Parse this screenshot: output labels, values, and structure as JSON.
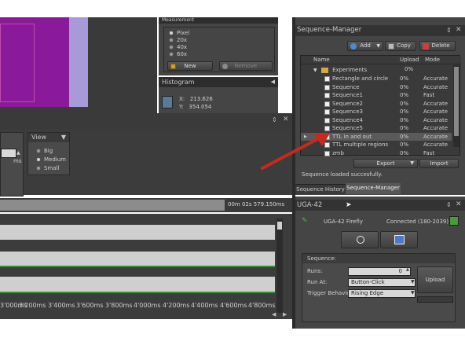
{
  "measurement": {
    "title": "Measurement",
    "options": [
      "Pixel",
      "20x",
      "40x",
      "60x"
    ],
    "selected": "Pixel",
    "new_label": "New",
    "remove_label": "Remove"
  },
  "histogram": {
    "title": "Histogram",
    "x_label": "X:",
    "x_value": "213.626",
    "y_label": "Y:",
    "y_value": "354.054"
  },
  "left_panel": {
    "unit": "ms",
    "view": {
      "title": "View",
      "options": [
        "Big",
        "Medium",
        "Small"
      ],
      "selected": "Medium"
    }
  },
  "timeline": {
    "time_readout": "00m 02s 579.150ms",
    "ticks": [
      "3'000ms",
      "3'200ms",
      "3'400ms",
      "3'600ms",
      "3'800ms",
      "4'000ms",
      "4'200ms",
      "4'400ms",
      "4'600ms",
      "4'800ms"
    ]
  },
  "sequence_manager": {
    "title": "Sequence-Manager",
    "add_label": "Add",
    "copy_label": "Copy",
    "delete_label": "Delete",
    "columns": {
      "name": "Name",
      "upload": "Upload",
      "mode": "Mode"
    },
    "folder": "Experiments",
    "rows": [
      {
        "name": "Rectangle and circle",
        "upload": "0%",
        "mode": "Accurate"
      },
      {
        "name": "Sequence",
        "upload": "0%",
        "mode": "Accurate"
      },
      {
        "name": "Sequence1",
        "upload": "0%",
        "mode": "Fast"
      },
      {
        "name": "Sequence2",
        "upload": "0%",
        "mode": "Accurate"
      },
      {
        "name": "Sequence3",
        "upload": "0%",
        "mode": "Accurate"
      },
      {
        "name": "Sequence4",
        "upload": "0%",
        "mode": "Accurate"
      },
      {
        "name": "Sequence5",
        "upload": "0%",
        "mode": "Accurate"
      },
      {
        "name": "TTL in and out",
        "upload": "0%",
        "mode": "Accurate"
      },
      {
        "name": "TTL multiple regions",
        "upload": "0%",
        "mode": "Accurate"
      },
      {
        "name": "zmb",
        "upload": "0%",
        "mode": "Fast"
      }
    ],
    "export_label": "Export",
    "import_label": "Import",
    "status": "Sequence loaded succesfully.",
    "tabs": [
      "Sequence History",
      "Sequence-Manager"
    ]
  },
  "uga": {
    "title": "UGA-42",
    "device": "UGA-42 Firefly",
    "connection": "Connected (180-2039)",
    "sequence_title": "Sequence:",
    "runs_label": "Runs:",
    "runs_value": "0",
    "run_at_label": "Run At:",
    "run_at_value": "Button-Click",
    "trigger_label": "Trigger Behavior:",
    "trigger_value": "Rising Edge",
    "upload_label": "Upload"
  },
  "colors": {
    "image_purple": "#8a1a9a",
    "image_lavender": "#a89ad8",
    "arrow_red": "#c8281e",
    "status_green": "#4caf50"
  }
}
